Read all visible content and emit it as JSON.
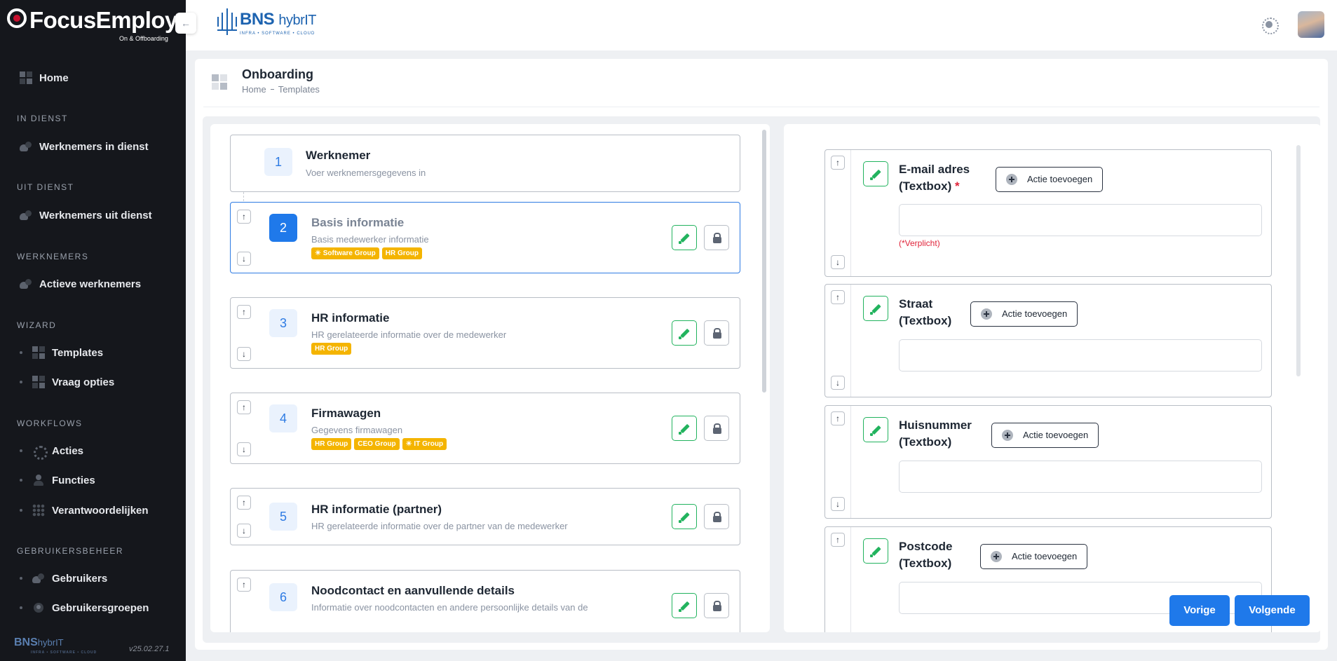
{
  "sidebar": {
    "brand": {
      "name": "FocusEmploy",
      "tagline": "On & Offboarding"
    },
    "collapse_icon": "arrow-left-icon",
    "home": "Home",
    "sections": [
      {
        "title": "IN DIENST",
        "items": [
          {
            "label": "Werknemers in dienst",
            "icon": "users-icon"
          }
        ]
      },
      {
        "title": "UIT DIENST",
        "items": [
          {
            "label": "Werknemers uit dienst",
            "icon": "users-icon"
          }
        ]
      },
      {
        "title": "WERKNEMERS",
        "items": [
          {
            "label": "Actieve werknemers",
            "icon": "users-icon"
          }
        ]
      },
      {
        "title": "WIZARD",
        "items": [
          {
            "label": "Templates",
            "icon": "grid-icon"
          },
          {
            "label": "Vraag opties",
            "icon": "grid-icon"
          }
        ]
      },
      {
        "title": "WORKFLOWS",
        "items": [
          {
            "label": "Acties",
            "icon": "gear-icon"
          },
          {
            "label": "Functies",
            "icon": "person-icon"
          },
          {
            "label": "Verantwoordelijken",
            "icon": "dots-icon"
          }
        ]
      },
      {
        "title": "GEBRUIKERSBEHEER",
        "items": [
          {
            "label": "Gebruikers",
            "icon": "users-icon"
          },
          {
            "label": "Gebruikersgroepen",
            "icon": "circle-icon"
          }
        ]
      }
    ],
    "footer_logo": {
      "name": "BNS",
      "suffix": "hybrIT",
      "tagline": "INFRA • SOFTWARE • CLOUD"
    },
    "version": "v25.02.27.1"
  },
  "topbar": {
    "logo": {
      "name": "BNS",
      "suffix": "hybrIT",
      "tagline": "INFRA • SOFTWARE • CLOUD"
    }
  },
  "page": {
    "title": "Onboarding",
    "breadcrumb": [
      "Home",
      "Templates"
    ]
  },
  "steps": [
    {
      "number": "1",
      "title": "Werknemer",
      "description": "Voer werknemersgegevens in",
      "tags": []
    },
    {
      "number": "2",
      "title": "Basis informatie",
      "description": "Basis medewerker informatie",
      "tags": [
        "☀ Software Group",
        "HR Group"
      ]
    },
    {
      "number": "3",
      "title": "HR informatie",
      "description": "HR gerelateerde informatie over de medewerker",
      "tags": [
        "HR Group"
      ]
    },
    {
      "number": "4",
      "title": "Firmawagen",
      "description": "Gegevens firmawagen",
      "tags": [
        "HR Group",
        "CEO Group",
        "☀ IT Group"
      ]
    },
    {
      "number": "5",
      "title": "HR informatie (partner)",
      "description": "HR gerelateerde informatie over de partner van de medewerker",
      "tags": []
    },
    {
      "number": "6",
      "title": "Noodcontact en aanvullende details",
      "description": "Informatie over noodcontacten en andere persoonlijke details van de",
      "tags": []
    }
  ],
  "fields": [
    {
      "label_line1": "E-mail adres",
      "label_line2": "(Textbox)",
      "required_mark": "*",
      "action_label": "Actie toevoegen",
      "value": "",
      "error": "(*Verplicht)"
    },
    {
      "label_line1": "Straat",
      "label_line2": "(Textbox)",
      "action_label": "Actie toevoegen",
      "value": ""
    },
    {
      "label_line1": "Huisnummer",
      "label_line2": "(Textbox)",
      "action_label": "Actie toevoegen",
      "value": ""
    },
    {
      "label_line1": "Postcode",
      "label_line2": "(Textbox)",
      "action_label": "Actie toevoegen",
      "value": ""
    }
  ],
  "nav_buttons": {
    "previous": "Vorige",
    "next": "Volgende"
  },
  "colors": {
    "primary": "#1f79ea",
    "edit": "#22b35e",
    "tag": "#f4b400",
    "sidebar": "#15171c",
    "required": "#e0243a"
  }
}
